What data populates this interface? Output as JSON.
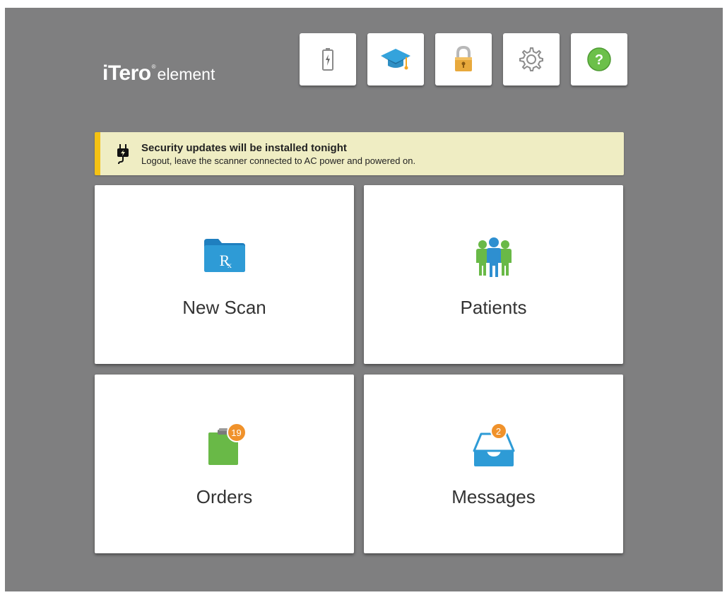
{
  "logo": {
    "brand": "iTero",
    "registered": "®",
    "product": "element"
  },
  "toolbar": {
    "items": [
      {
        "name": "battery",
        "icon": "battery-icon"
      },
      {
        "name": "training",
        "icon": "graduation-cap-icon"
      },
      {
        "name": "lock",
        "icon": "lock-icon"
      },
      {
        "name": "settings",
        "icon": "gear-icon"
      },
      {
        "name": "help",
        "icon": "help-icon"
      }
    ]
  },
  "banner": {
    "icon": "power-plug-icon",
    "title": "Security updates will be installed tonight",
    "message": "Logout, leave the scanner connected to AC power and powered on.",
    "accent_color": "#f5c213",
    "background": "#efedc3"
  },
  "tiles": {
    "new_scan": {
      "label": "New Scan",
      "icon": "rx-folder-icon"
    },
    "patients": {
      "label": "Patients",
      "icon": "patients-icon"
    },
    "orders": {
      "label": "Orders",
      "icon": "clipboard-icon",
      "badge": "19"
    },
    "messages": {
      "label": "Messages",
      "icon": "inbox-icon",
      "badge": "2"
    }
  },
  "colors": {
    "background": "#7f7f80",
    "tile": "#ffffff",
    "badge": "#f0922b",
    "folder": "#2e9bd6",
    "green": "#69b947"
  }
}
